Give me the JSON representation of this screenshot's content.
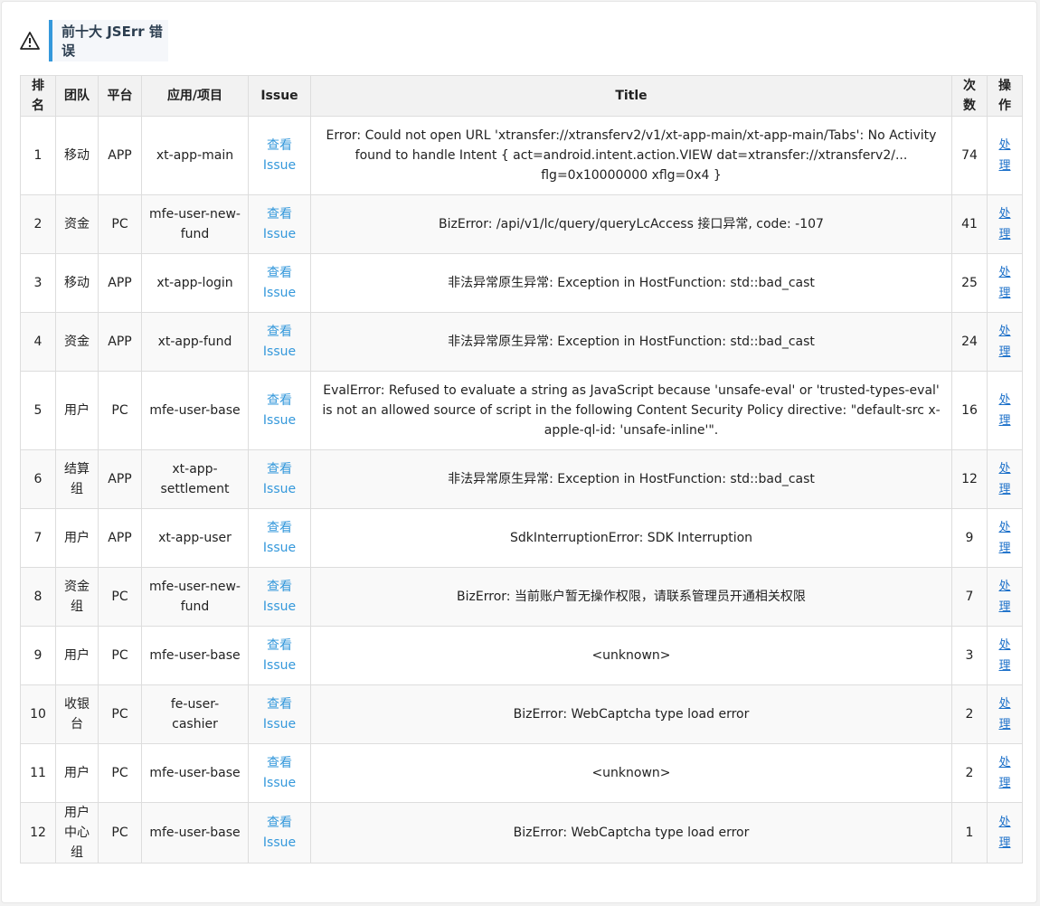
{
  "header": {
    "title": "前十大 JSErr 错误"
  },
  "colors": {
    "accent": "#3498db",
    "link": "#1a6fc9",
    "warning_icon": "#222222"
  },
  "table": {
    "columns": [
      "排名",
      "团队",
      "平台",
      "应用/项目",
      "Issue",
      "Title",
      "次数",
      "操作"
    ],
    "rows": [
      {
        "rank": "1",
        "team": "移动",
        "platform": "APP",
        "app": "xt-app-main",
        "issue": "查看 Issue",
        "title": "Error: Could not open URL 'xtransfer://xtransferv2/v1/xt-app-main/xt-app-main/Tabs': No Activity found to handle Intent { act=android.intent.action.VIEW dat=xtransfer://xtransferv2/... flg=0x10000000 xflg=0x4 }",
        "count": "74",
        "action": "处理"
      },
      {
        "rank": "2",
        "team": "资金",
        "platform": "PC",
        "app": "mfe-user-new-fund",
        "issue": "查看 Issue",
        "title": "BizError: /api/v1/lc/query/queryLcAccess 接口异常, code: -107",
        "count": "41",
        "action": "处理"
      },
      {
        "rank": "3",
        "team": "移动",
        "platform": "APP",
        "app": "xt-app-login",
        "issue": "查看 Issue",
        "title": "非法异常原生异常: Exception in HostFunction: std::bad_cast",
        "count": "25",
        "action": "处理"
      },
      {
        "rank": "4",
        "team": "资金",
        "platform": "APP",
        "app": "xt-app-fund",
        "issue": "查看 Issue",
        "title": "非法异常原生异常: Exception in HostFunction: std::bad_cast",
        "count": "24",
        "action": "处理"
      },
      {
        "rank": "5",
        "team": "用户",
        "platform": "PC",
        "app": "mfe-user-base",
        "issue": "查看 Issue",
        "title": "EvalError: Refused to evaluate a string as JavaScript because 'unsafe-eval' or 'trusted-types-eval' is not an allowed source of script in the following Content Security Policy directive: \"default-src x-apple-ql-id: 'unsafe-inline'\".",
        "count": "16",
        "action": "处理"
      },
      {
        "rank": "6",
        "team": "结算组",
        "platform": "APP",
        "app": "xt-app-settlement",
        "issue": "查看 Issue",
        "title": "非法异常原生异常: Exception in HostFunction: std::bad_cast",
        "count": "12",
        "action": "处理"
      },
      {
        "rank": "7",
        "team": "用户",
        "platform": "APP",
        "app": "xt-app-user",
        "issue": "查看 Issue",
        "title": "SdkInterruptionError: SDK Interruption",
        "count": "9",
        "action": "处理"
      },
      {
        "rank": "8",
        "team": "资金组",
        "platform": "PC",
        "app": "mfe-user-new-fund",
        "issue": "查看 Issue",
        "title": "BizError: 当前账户暂无操作权限，请联系管理员开通相关权限",
        "count": "7",
        "action": "处理"
      },
      {
        "rank": "9",
        "team": "用户",
        "platform": "PC",
        "app": "mfe-user-base",
        "issue": "查看 Issue",
        "title": "<unknown>",
        "count": "3",
        "action": "处理"
      },
      {
        "rank": "10",
        "team": "收银台",
        "platform": "PC",
        "app": "fe-user-cashier",
        "issue": "查看 Issue",
        "title": "BizError: WebCaptcha type load error",
        "count": "2",
        "action": "处理"
      },
      {
        "rank": "11",
        "team": "用户",
        "platform": "PC",
        "app": "mfe-user-base",
        "issue": "查看 Issue",
        "title": "<unknown>",
        "count": "2",
        "action": "处理"
      },
      {
        "rank": "12",
        "team": "用户中心组",
        "platform": "PC",
        "app": "mfe-user-base",
        "issue": "查看 Issue",
        "title": "BizError: WebCaptcha type load error",
        "count": "1",
        "action": "处理"
      }
    ]
  }
}
